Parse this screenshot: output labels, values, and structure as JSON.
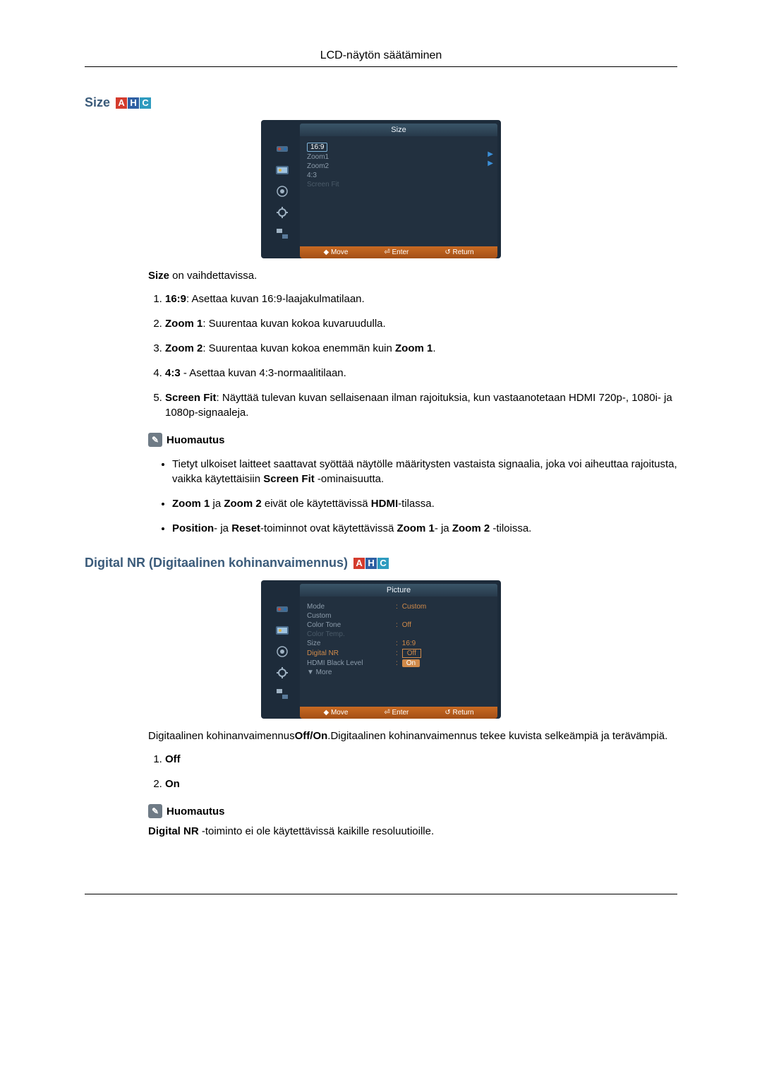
{
  "header": {
    "title": "LCD-näytön säätäminen"
  },
  "badges": {
    "a": "A",
    "h": "H",
    "c": "C"
  },
  "size_section": {
    "heading": "Size",
    "osd": {
      "title": "Size",
      "items": [
        "16:9",
        "Zoom1",
        "Zoom2",
        "4:3",
        "Screen Fit"
      ],
      "footer_move": "◆ Move",
      "footer_enter": "⏎ Enter",
      "footer_return": "↺ Return"
    },
    "intro_prefix": "Size",
    "intro_rest": " on vaihdettavissa.",
    "list": [
      {
        "b": "16:9",
        "rest": ": Asettaa kuvan 16:9-laajakulmatilaan."
      },
      {
        "b": "Zoom 1",
        "rest": ": Suurentaa kuvan kokoa kuvaruudulla."
      },
      {
        "b": "Zoom 2",
        "rest_pre": ": Suurentaa kuvan kokoa enemmän kuin ",
        "b2": "Zoom 1",
        "rest_post": "."
      },
      {
        "b": "4:3",
        "rest": " - Asettaa kuvan 4:3-normaalitilaan."
      },
      {
        "b": "Screen Fit",
        "rest": ": Näyttää tulevan kuvan sellaisenaan ilman rajoituksia, kun vastaanotetaan HDMI 720p-, 1080i- ja 1080p-signaaleja."
      }
    ],
    "note_label": "Huomautus",
    "bullets": [
      {
        "pre": "Tietyt ulkoiset laitteet saattavat syöttää näytölle määritysten vastaista signaalia, joka voi aiheuttaa rajoitusta, vaikka käytettäisiin ",
        "b": "Screen Fit",
        "post": " -ominaisuutta."
      },
      {
        "b1": "Zoom 1",
        "mid1": " ja ",
        "b2": "Zoom 2",
        "mid2": " eivät ole käytettävissä ",
        "b3": "HDMI",
        "post": "-tilassa."
      },
      {
        "b1": "Position",
        "mid1": "- ja ",
        "b2": "Reset",
        "mid2": "-toiminnot ovat käytettävissä ",
        "b3": "Zoom 1",
        "mid3": "- ja ",
        "b4": "Zoom 2",
        "post": " -tiloissa."
      }
    ]
  },
  "nr_section": {
    "heading": "Digital NR (Digitaalinen kohinanvaimennus)",
    "osd": {
      "title": "Picture",
      "rows": [
        {
          "label": "Mode",
          "val": "Custom"
        },
        {
          "label": "Custom",
          "val": ""
        },
        {
          "label": "Color Tone",
          "val": "Off"
        },
        {
          "label": "Color Temp.",
          "val": ""
        },
        {
          "label": "Size",
          "val": "16:9"
        },
        {
          "label": "Digital NR",
          "val": "Off",
          "highlight_label": true
        },
        {
          "label": "HDMI Black Level",
          "val": "On",
          "highlight_val": true
        },
        {
          "label": "▼ More",
          "val": ""
        }
      ],
      "footer_move": "◆ Move",
      "footer_enter": "⏎ Enter",
      "footer_return": "↺ Return"
    },
    "intro_pre": "Digitaalinen kohinanvaimennus",
    "intro_b": "Off/On",
    "intro_post": ".Digitaalinen kohinanvaimennus tekee kuvista selkeämpiä ja terävämpiä.",
    "list": [
      {
        "b": "Off"
      },
      {
        "b": "On"
      }
    ],
    "note_label": "Huomautus",
    "note_text_b": "Digital NR",
    "note_text_rest": " -toiminto ei ole käytettävissä kaikille resoluutioille."
  }
}
